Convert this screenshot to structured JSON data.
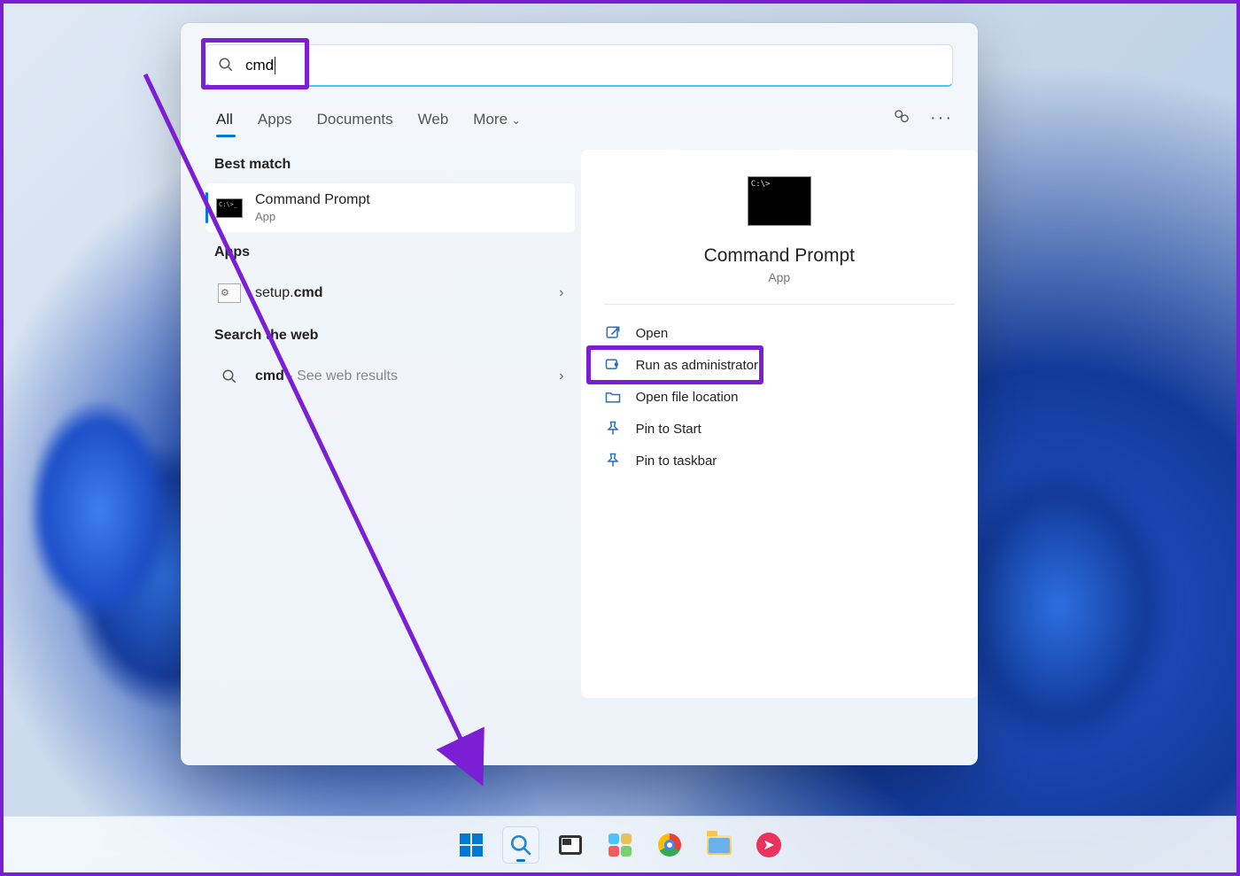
{
  "search": {
    "query": "cmd"
  },
  "tabs": {
    "all": "All",
    "apps": "Apps",
    "documents": "Documents",
    "web": "Web",
    "more": "More"
  },
  "sections": {
    "best": "Best match",
    "apps": "Apps",
    "web": "Search the web"
  },
  "best_match": {
    "title": "Command Prompt",
    "sub": "App"
  },
  "app_result": {
    "prefix": "setup.",
    "bold": "cmd"
  },
  "web_result": {
    "term": "cmd",
    "suffix": " - See web results"
  },
  "preview": {
    "title": "Command Prompt",
    "sub": "App"
  },
  "actions": {
    "open": "Open",
    "admin": "Run as administrator",
    "loc": "Open file location",
    "pinstart": "Pin to Start",
    "pintask": "Pin to taskbar"
  }
}
